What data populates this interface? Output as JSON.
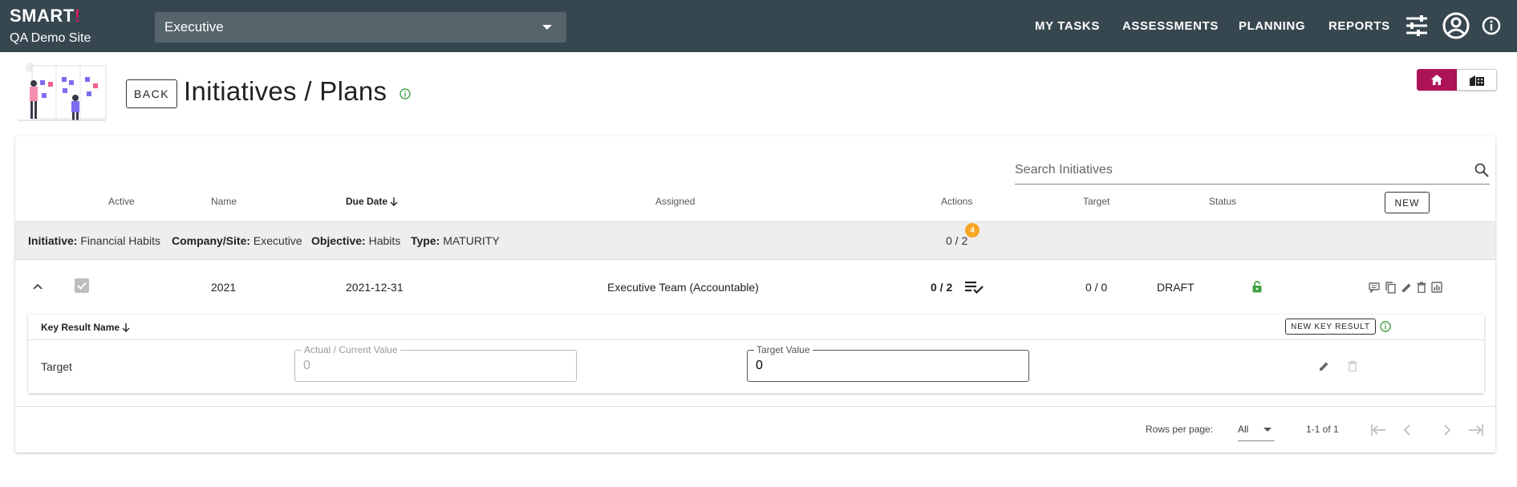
{
  "app": {
    "brand_logo": "SMART",
    "brand_logo_accent": "!",
    "site_name": "QA Demo Site",
    "site_selector_value": "Executive"
  },
  "nav": {
    "items": [
      "MY TASKS",
      "ASSESSMENTS",
      "PLANNING",
      "REPORTS"
    ],
    "icons": [
      "tune-icon",
      "account-circle-icon",
      "info-icon"
    ]
  },
  "header": {
    "back_label": "BACK",
    "title": "Initiatives / Plans"
  },
  "search": {
    "placeholder": "Search Initiatives"
  },
  "table": {
    "columns": {
      "active": "Active",
      "name": "Name",
      "due_date": "Due Date",
      "assigned": "Assigned",
      "actions": "Actions",
      "target": "Target",
      "status": "Status"
    },
    "new_label": "NEW",
    "group": {
      "initiative_label": "Initiative:",
      "initiative_value": "Financial Habits",
      "company_label": "Company/Site:",
      "company_value": "Executive",
      "objective_label": "Objective:",
      "objective_value": "Habits",
      "type_label": "Type:",
      "type_value": "MATURITY",
      "actions_count": "0 / 2",
      "badge": "4"
    },
    "row": {
      "name": "2021",
      "due_date": "2021-12-31",
      "assigned": "Executive Team (Accountable)",
      "actions": "0 / 2",
      "target": "0 / 0",
      "status": "DRAFT",
      "active_checked": true
    }
  },
  "key_results": {
    "column_name": "Key Result Name",
    "new_label": "NEW KEY RESULT",
    "rows": [
      {
        "name": "Target",
        "actual_label": "Actual / Current Value",
        "actual_value": "0",
        "target_label": "Target Value",
        "target_value": "0"
      }
    ]
  },
  "pagination": {
    "rows_per_page_label": "Rows per page:",
    "rows_per_page_value": "All",
    "range": "1-1 of 1"
  },
  "colors": {
    "topbar": "#37474f",
    "accent": "#ad1457",
    "badge": "#f5a623",
    "success": "#43a047"
  }
}
